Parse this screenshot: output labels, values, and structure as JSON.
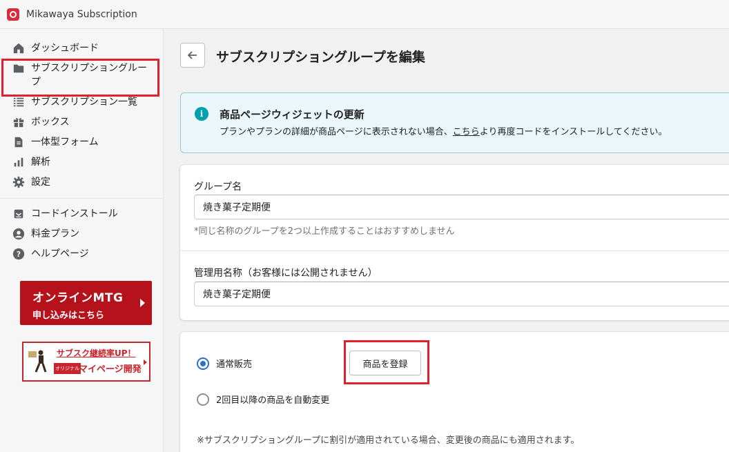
{
  "app": {
    "title": "Mikawaya Subscription"
  },
  "sidebar": {
    "items": [
      {
        "label": "ダッシュボード",
        "icon": "home-icon"
      },
      {
        "label": "サブスクリプショングループ",
        "icon": "folder-icon"
      },
      {
        "label": "サブスクリプション一覧",
        "icon": "list-icon"
      },
      {
        "label": "ボックス",
        "icon": "gift-icon"
      },
      {
        "label": "一体型フォーム",
        "icon": "document-icon"
      },
      {
        "label": "解析",
        "icon": "bar-chart-icon"
      },
      {
        "label": "設定",
        "icon": "gear-icon"
      }
    ],
    "items2": [
      {
        "label": "コードインストール",
        "icon": "code-install-icon"
      },
      {
        "label": "料金プラン",
        "icon": "user-icon"
      },
      {
        "label": "ヘルプページ",
        "icon": "help-icon"
      }
    ],
    "banner1": {
      "line1": "オンラインMTG",
      "line2": "申し込みはこちら"
    },
    "banner2": {
      "line1": "サブスク継続率UP！",
      "tag": "オリジナル",
      "line2": "マイページ開発"
    }
  },
  "page": {
    "title": "サブスクリプショングループを編集"
  },
  "info": {
    "title": "商品ページウィジェットの更新",
    "desc_before": "プランやプランの詳細が商品ページに表示されない場合、",
    "link": "こちら",
    "desc_after": "より再度コードをインストールしてください。"
  },
  "form": {
    "group_name_label": "グループ名",
    "group_name_value": "焼き菓子定期便",
    "group_name_help": "*同じ名称のグループを2つ以上作成することはおすすめしません",
    "admin_name_label": "管理用名称（お客様には公開されません）",
    "admin_name_value": "焼き菓子定期便"
  },
  "sales": {
    "option1": "通常販売",
    "option2": "2回目以降の商品を自動変更",
    "register_button": "商品を登録",
    "note": "※サブスクリプショングループに割引が適用されている場合、変更後の商品にも適用されます。"
  },
  "colors": {
    "accent": "#2c6ecb",
    "highlight": "#e0202c",
    "info_bg": "#eaf6f9",
    "info_icon": "#00a0ac"
  }
}
